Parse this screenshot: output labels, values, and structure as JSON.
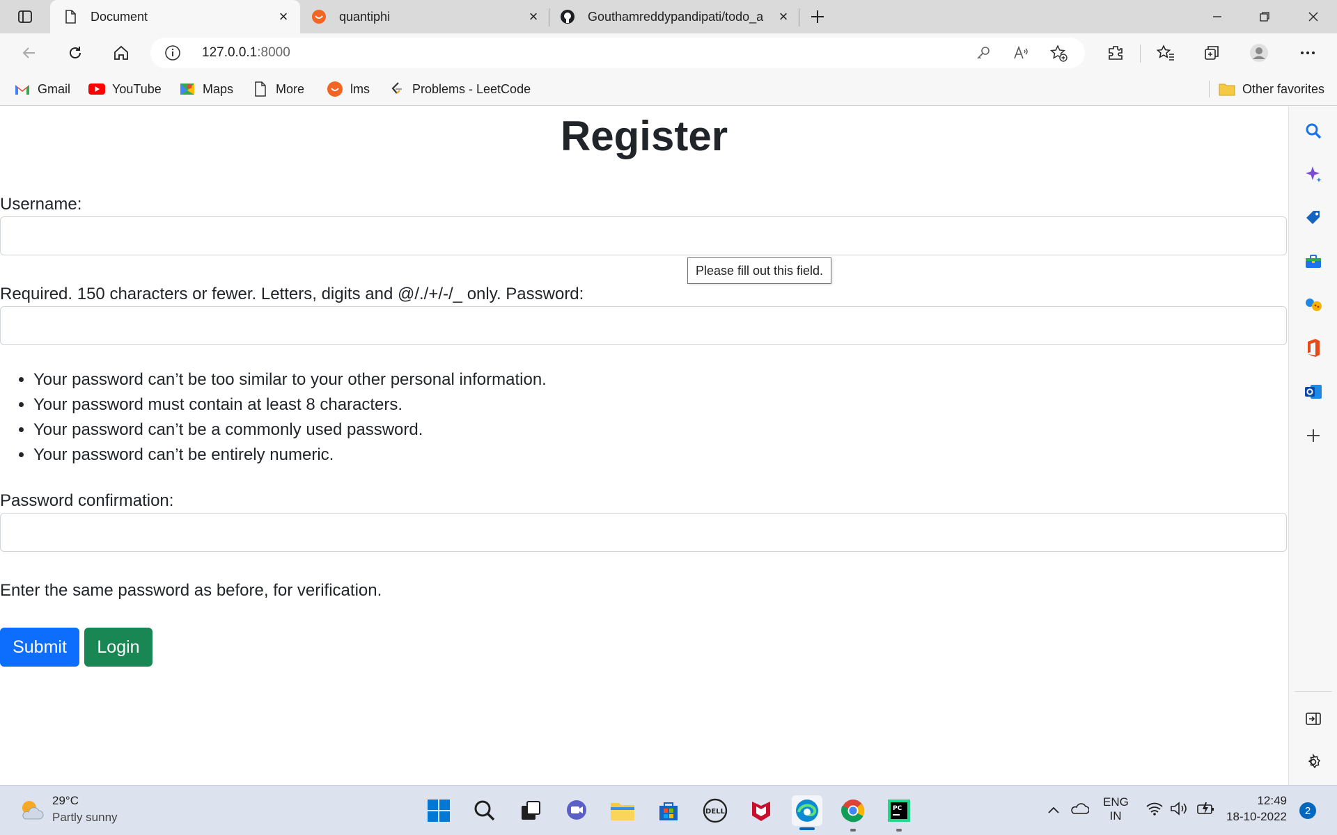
{
  "browser": {
    "tabs": [
      {
        "title": "Document",
        "active": true,
        "icon": "document-icon"
      },
      {
        "title": "quantiphi",
        "active": false,
        "icon": "quantiphi-logo"
      },
      {
        "title": "Gouthamreddypandipati/todo_a",
        "active": false,
        "icon": "github-icon"
      }
    ],
    "address": {
      "host": "127.0.0.1",
      "port": ":8000"
    },
    "favorites": [
      {
        "label": "Gmail",
        "icon": "gmail-icon"
      },
      {
        "label": "YouTube",
        "icon": "youtube-icon"
      },
      {
        "label": "Maps",
        "icon": "maps-icon"
      },
      {
        "label": "More",
        "icon": "page-icon"
      },
      {
        "label": "lms",
        "icon": "lms-icon"
      },
      {
        "label": "Problems - LeetCode",
        "icon": "leetcode-icon"
      }
    ],
    "other_favorites": "Other favorites"
  },
  "page": {
    "title": "Register",
    "username_label": "Username:",
    "username_help_and_password_label": "Required. 150 characters or fewer. Letters, digits and @/./+/-/_ only. Password:",
    "tooltip": "Please fill out this field.",
    "password_rules": [
      "Your password can’t be too similar to your other personal information.",
      "Your password must contain at least 8 characters.",
      "Your password can’t be a commonly used password.",
      "Your password can’t be entirely numeric."
    ],
    "confirm_label": "Password confirmation:",
    "confirm_help": "Enter the same password as before, for verification.",
    "submit_label": "Submit",
    "login_label": "Login",
    "colors": {
      "submit": "#0d6efd",
      "login": "#198754"
    }
  },
  "taskbar": {
    "weather": {
      "temp": "29°C",
      "condition": "Partly sunny"
    },
    "lang": {
      "line1": "ENG",
      "line2": "IN"
    },
    "clock": {
      "time": "12:49",
      "date": "18-10-2022"
    },
    "notifications": "2"
  }
}
